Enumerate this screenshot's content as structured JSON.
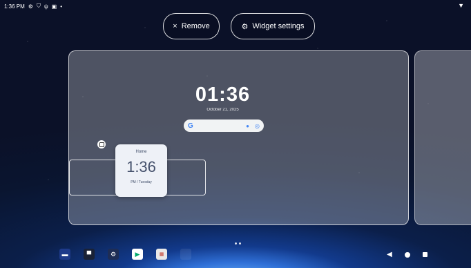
{
  "status_bar": {
    "time": "1:36 PM",
    "icons": [
      "settings-icon",
      "shield-icon",
      "usb-icon",
      "screenshot-icon",
      "dot-icon"
    ],
    "right_icon": "wifi-icon"
  },
  "top_actions": {
    "remove": {
      "icon": "×",
      "label": "Remove"
    },
    "widget_settings": {
      "icon": "⚙",
      "label": "Widget settings"
    }
  },
  "home_preview": {
    "clock": "01:36",
    "date": "October 21, 2025",
    "search_bar": {
      "logo": "G",
      "mic_icon": "mic-icon",
      "lens_icon": "lens-icon"
    }
  },
  "clock_widget": {
    "label": "Home",
    "time": "1:36",
    "subtitle": "PM / Tuesday"
  },
  "dock": {
    "apps": [
      "app-1",
      "files",
      "settings",
      "play-store",
      "multi-app"
    ]
  },
  "nav": {
    "back": "◀",
    "home": "home",
    "recents": "recents"
  }
}
